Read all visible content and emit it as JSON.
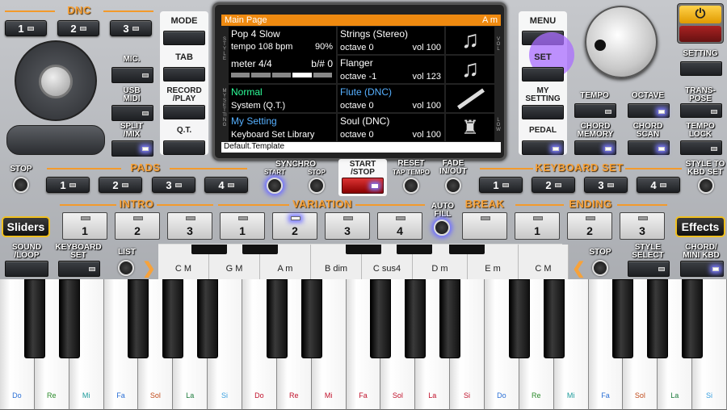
{
  "colors": {
    "accent": "#f39a2c",
    "screen_header": "#ef8a10",
    "led_on": "#7b7bff",
    "dnc_text": "#56b0ff",
    "normal_text": "#2dff9a"
  },
  "dnc": {
    "label": "DNC",
    "btn1": "1",
    "btn2": "2",
    "btn3": "3"
  },
  "left": {
    "mic": "MIC.",
    "usb_midi": "USB\nMIDI",
    "split_mix": "SPLIT\n/MIX",
    "mode": "MODE",
    "tab": "TAB",
    "record_play": "RECORD\n/PLAY",
    "qt": "Q.T."
  },
  "screen": {
    "title": "Main Page",
    "chord": "A m",
    "style": {
      "name": "Pop 4 Slow",
      "tempo": "tempo 108 bpm",
      "percent": "90%",
      "meter": "meter 4/4",
      "key": "b/#  0"
    },
    "part1": {
      "name": "Strings (Stereo)",
      "octave": "octave  0",
      "vol": "vol 100"
    },
    "part2": {
      "name": "Flanger",
      "octave": "octave -1",
      "vol": "vol 123"
    },
    "part3": {
      "name": "Flute (DNC)",
      "octave": "octave  0",
      "vol": "vol 100"
    },
    "part4": {
      "name": "Soul (DNC)",
      "octave": "octave  0",
      "vol": "vol 100"
    },
    "sys": {
      "name": "Normal",
      "sub": "System (Q.T.)"
    },
    "mysetting": {
      "name": "My Setting",
      "sub": "Keyboard Set Library"
    },
    "footer": "Default.Template",
    "side_style": "STYLE",
    "side_mysetting": "MY SETTING",
    "side_vol": "VOL",
    "side_low": "LOW"
  },
  "right": {
    "menu": "MENU",
    "set": "SET",
    "my_setting": "MY\nSETTING",
    "pedal": "PEDAL",
    "setting": "SETTING",
    "tempo": "TEMPO",
    "octave": "OCTAVE",
    "transpose": "TRANS-\nPOSE",
    "chord_memory": "CHORD\nMEMORY",
    "chord_scan": "CHORD\nSCAN",
    "tempo_lock": "TEMPO\nLOCK"
  },
  "middle": {
    "stop": "STOP",
    "pads": "PADS",
    "pad1": "1",
    "pad2": "2",
    "pad3": "3",
    "pad4": "4",
    "synchro": "SYNCHRO",
    "sync_start": "START",
    "sync_stop": "STOP",
    "start_stop": "START\n/STOP",
    "reset": "RESET",
    "tap_tempo": "TAP TEMPO",
    "fade": "FADE\nIN/OUT",
    "keyboard_set": "KEYBOARD SET",
    "ks1": "1",
    "ks2": "2",
    "ks3": "3",
    "ks4": "4",
    "style_to_kbd": "STYLE TO\nKBD SET"
  },
  "arranger": {
    "intro": "INTRO",
    "variation": "VARIATION",
    "break": "BREAK",
    "ending": "ENDING",
    "auto_fill": "AUTO\nFILL",
    "sliders": "Sliders",
    "effects": "Effects",
    "intro_btns": [
      "1",
      "2",
      "3"
    ],
    "var_btns": [
      "1",
      "2",
      "3",
      "4"
    ],
    "ending_btns": [
      "1",
      "2",
      "3"
    ]
  },
  "lower": {
    "sound_loop": "SOUND\n/LOOP",
    "keyboard_set": "KEYBOARD\nSET",
    "list": "LIST",
    "stop": "STOP",
    "style_select": "STYLE\nSELECT",
    "chord_mini_kbd": "CHORD/\nMINI KBD"
  },
  "chords": [
    "C M",
    "G M",
    "A m",
    "B dim",
    "C sus4",
    "D m",
    "E m",
    "C M"
  ],
  "notes": [
    "Do",
    "Re",
    "Mi",
    "Fa",
    "Sol",
    "La",
    "Si",
    "Do",
    "Re",
    "Mi",
    "Fa",
    "Sol",
    "La",
    "Si",
    "Do",
    "Re",
    "Mi",
    "Fa",
    "Sol",
    "La",
    "Si"
  ]
}
